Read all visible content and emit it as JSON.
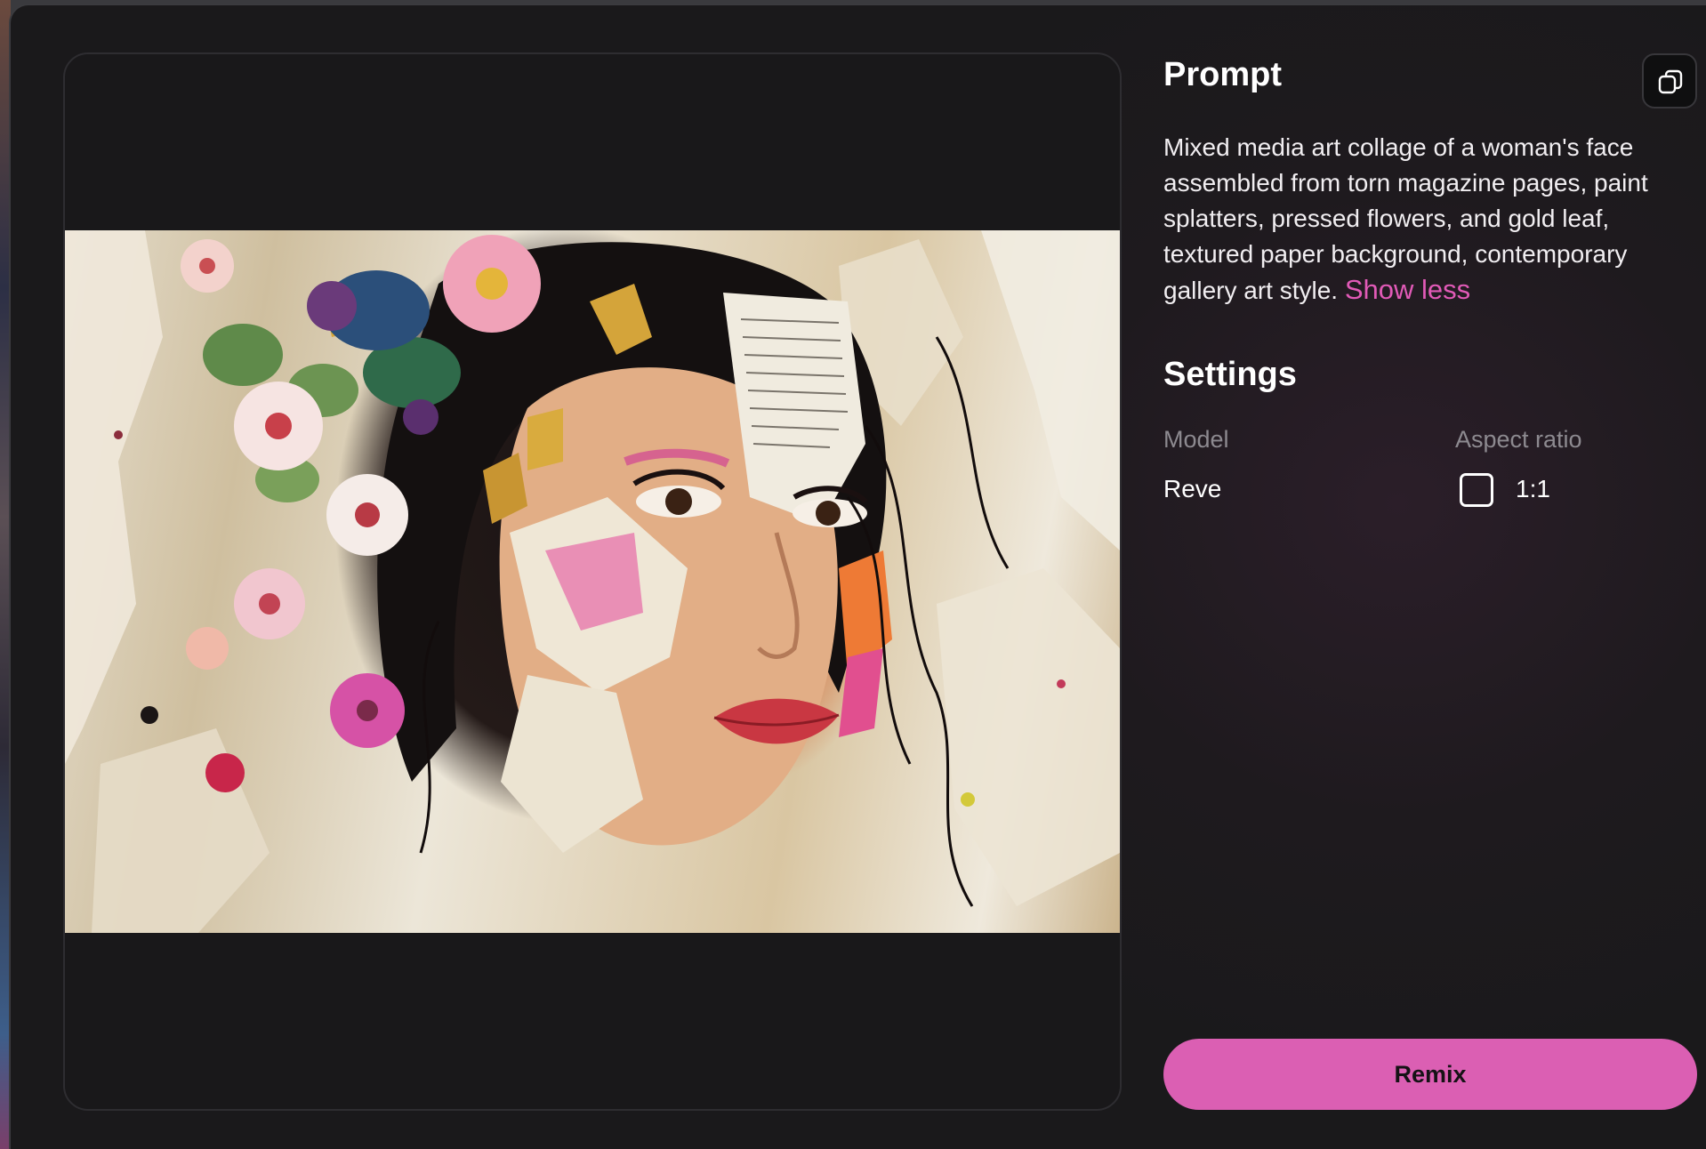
{
  "prompt": {
    "title": "Prompt",
    "text": "Mixed media art collage of a woman's face assembled from torn magazine pages, paint splatters, pressed flowers, and gold leaf, textured paper background, contemporary gallery art style.",
    "toggle_label": "Show less",
    "copy_icon": "copy-icon"
  },
  "settings": {
    "title": "Settings",
    "model_label": "Model",
    "model_value": "Reve",
    "aspect_label": "Aspect ratio",
    "aspect_value": "1:1",
    "aspect_icon": "square-aspect-icon"
  },
  "actions": {
    "remix_label": "Remix"
  },
  "colors": {
    "accent": "#db5fb3",
    "link": "#e15ab7",
    "background": "#1a191b"
  }
}
